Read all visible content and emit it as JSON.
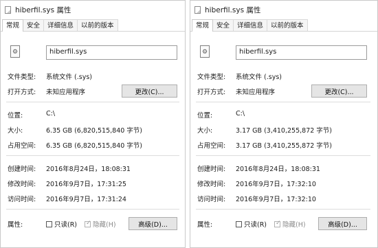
{
  "left": {
    "title": "hiberfil.sys 属性",
    "tabs": [
      "常规",
      "安全",
      "详细信息",
      "以前的版本"
    ],
    "filename": "hiberfil.sys",
    "labels": {
      "type": "文件类型:",
      "open_with": "打开方式:",
      "location": "位置:",
      "size": "大小:",
      "size_on_disk": "占用空间:",
      "created": "创建时间:",
      "modified": "修改时间:",
      "accessed": "访问时间:",
      "attributes": "属性:"
    },
    "values": {
      "type": "系统文件 (.sys)",
      "open_with": "未知应用程序",
      "location": "C:\\",
      "size": "6.35 GB (6,820,515,840 字节)",
      "size_on_disk": "6.35 GB (6,820,515,840 字节)",
      "created": "2016年8月24日，18:08:31",
      "modified": "2016年9月7日，17:31:25",
      "accessed": "2016年9月7日，17:31:24"
    },
    "change_button": "更改(C)...",
    "readonly_label": "只读(R)",
    "hidden_label": "隐藏(H)",
    "advanced_button": "高级(D)..."
  },
  "right": {
    "title": "hiberfil.sys 属性",
    "tabs": [
      "常规",
      "安全",
      "详细信息",
      "以前的版本"
    ],
    "filename": "hiberfil.sys",
    "labels": {
      "type": "文件类型:",
      "open_with": "打开方式:",
      "location": "位置:",
      "size": "大小:",
      "size_on_disk": "占用空间:",
      "created": "创建时间:",
      "modified": "修改时间:",
      "accessed": "访问时间:",
      "attributes": "属性:"
    },
    "values": {
      "type": "系统文件 (.sys)",
      "open_with": "未知应用程序",
      "location": "C:\\",
      "size": "3.17 GB (3,410,255,872 字节)",
      "size_on_disk": "3.17 GB (3,410,255,872 字节)",
      "created": "2016年8月24日，18:08:31",
      "modified": "2016年9月7日，17:32:10",
      "accessed": "2016年9月7日，17:32:10"
    },
    "change_button": "更改(C)...",
    "readonly_label": "只读(R)",
    "hidden_label": "隐藏(H)",
    "advanced_button": "高级(D)..."
  }
}
